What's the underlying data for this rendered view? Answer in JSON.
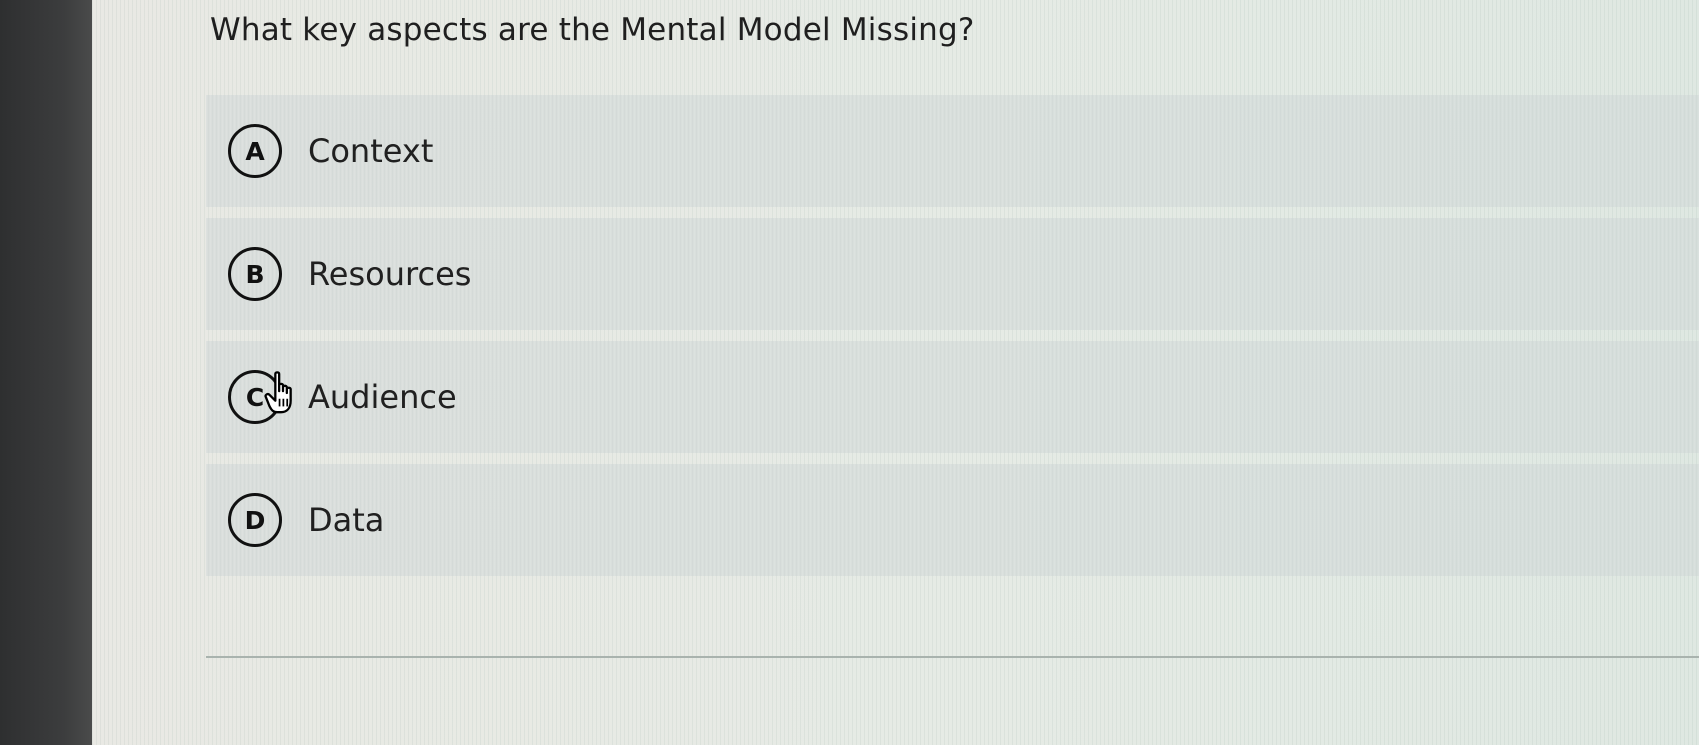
{
  "question": {
    "text": "What key aspects are the Mental Model Missing?"
  },
  "options": [
    {
      "letter": "A",
      "label": "Context"
    },
    {
      "letter": "B",
      "label": "Resources"
    },
    {
      "letter": "C",
      "label": "Audience"
    },
    {
      "letter": "D",
      "label": "Data"
    }
  ],
  "cursor": {
    "icon": "hand-pointer-icon"
  },
  "colors": {
    "screen_background": "#e7ebe6",
    "option_background": "#cdd6d5",
    "text": "#1f1f1f",
    "badge_border": "#111111"
  }
}
